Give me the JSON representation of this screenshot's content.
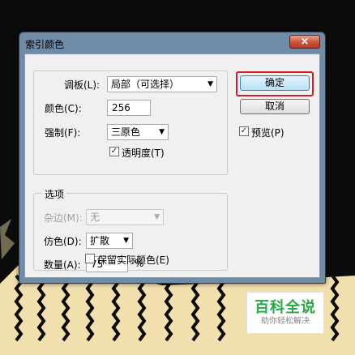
{
  "dialog": {
    "title": "索引颜色",
    "close_label": "×"
  },
  "palette_group": {
    "palette_label": "调板(L):",
    "palette_value": "局部（可选择）",
    "colors_label": "颜色(C):",
    "colors_value": "256",
    "forced_label": "强制(F):",
    "forced_value": "三原色",
    "transparency_label": "透明度(T)",
    "transparency_checked": true
  },
  "options_group": {
    "legend": "选项",
    "matte_label": "杂边(M):",
    "matte_value": "无",
    "dither_label": "仿色(D):",
    "dither_value": "扩散",
    "amount_label": "数量(A):",
    "amount_value": "75",
    "amount_unit": "%",
    "preserve_label": "保留实际颜色(E)",
    "preserve_checked": false
  },
  "buttons": {
    "ok_label": "确定",
    "cancel_label": "取消"
  },
  "preview": {
    "label": "预览(P)",
    "checked": true
  },
  "watermark": {
    "title": "百科全说",
    "subtitle": "助你轻松解决"
  },
  "colors": {
    "focus_ring": "#d21c2a",
    "photo_light": "#f2dfae",
    "photo_dark": "#0c0c0c",
    "watermark_green": "#28a745"
  }
}
